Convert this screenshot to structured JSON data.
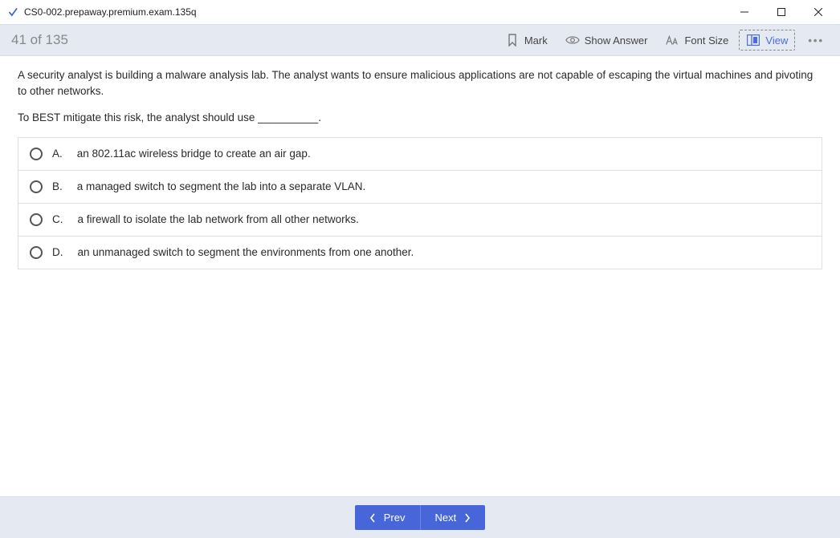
{
  "window": {
    "title": "CS0-002.prepaway.premium.exam.135q"
  },
  "toolbar": {
    "progress": "41 of 135",
    "mark": "Mark",
    "show_answer": "Show Answer",
    "font_size": "Font Size",
    "view": "View"
  },
  "question": {
    "body1": "A security analyst is building a malware analysis lab. The analyst wants to ensure malicious applications are not capable of escaping the virtual machines and pivoting to other networks.",
    "body2": "To BEST mitigate this risk, the analyst should use __________.",
    "options": [
      {
        "letter": "A.",
        "text": "an 802.11ac wireless bridge to create an air gap."
      },
      {
        "letter": "B.",
        "text": "a managed switch to segment the lab into a separate VLAN."
      },
      {
        "letter": "C.",
        "text": "a firewall to isolate the lab network from all other networks."
      },
      {
        "letter": "D.",
        "text": "an unmanaged switch to segment the environments from one another."
      }
    ]
  },
  "nav": {
    "prev": "Prev",
    "next": "Next"
  }
}
